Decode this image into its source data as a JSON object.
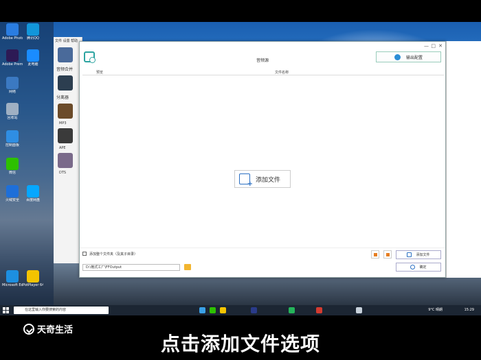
{
  "desktop": {
    "icons": [
      {
        "label": "Adobe Photoshop",
        "color": "#2a7de1"
      },
      {
        "label": "腾讯QQ",
        "color": "#1296db"
      },
      {
        "label": "Adobe Premiere",
        "color": "#2d1a55"
      },
      {
        "label": "此电脑",
        "color": "#1a8cff"
      },
      {
        "label": "网络",
        "color": "#3b79c2"
      },
      {
        "label": "回收站",
        "color": "#9fb0c3"
      },
      {
        "label": "控制面板",
        "color": "#2f8ee3"
      },
      {
        "label": "微信",
        "color": "#2dc100"
      },
      {
        "label": "火绒安全",
        "color": "#1e6fd9"
      },
      {
        "label": "百度网盘",
        "color": "#06a7ff"
      },
      {
        "label": "Microsoft Edge",
        "color": "#1d8fe0"
      },
      {
        "label": "PotPlayer 64 bit",
        "color": "#f4c400"
      }
    ]
  },
  "bg_app": {
    "menu": "文件  设置  帮助",
    "category1": "音频合并",
    "category2": "分离器",
    "formats": [
      "MP3",
      "APE",
      "DTS"
    ]
  },
  "dialog": {
    "title": "音频源",
    "output_settings_label": "输出配置",
    "col_name": "预览",
    "col_file": "文件名称",
    "add_file_center": "添加文件",
    "checkbox_label": "添加整个文件夹（及其子目录）",
    "output_path": "D:\\格式工厂\\FFOutput",
    "add_file_btn": "添加文件",
    "ok_btn": "确定",
    "win_min": "—",
    "win_max": "□",
    "win_close": "✕"
  },
  "taskbar": {
    "search_placeholder": "在这里输入你要搜索的内容",
    "weather": "9°C 晴朗",
    "time": "15:29"
  },
  "overlay": {
    "brand": "天奇生活",
    "subtitle": "点击添加文件选项"
  }
}
